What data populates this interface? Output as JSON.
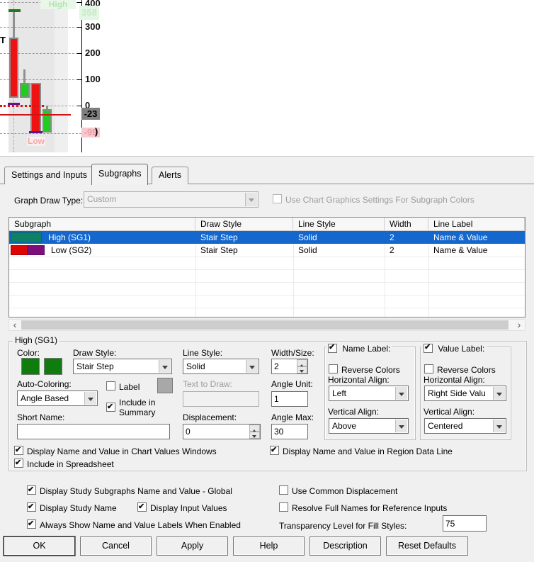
{
  "chart": {
    "y_axis": [
      "400",
      "300",
      "200",
      "100",
      "0"
    ],
    "last_price_badge": "-23",
    "low_value_badge": "-99",
    "high_value_badge": "358",
    "series_high_label": "High",
    "series_low_label": "Low",
    "clipped_paren": ")",
    "clipped_left_text": "T"
  },
  "icons": {
    "scroll_left": "‹",
    "scroll_right": "›"
  },
  "dialog": {
    "tabs": [
      {
        "label": "Settings and Inputs"
      },
      {
        "label": "Subgraphs"
      },
      {
        "label": "Alerts"
      }
    ],
    "graph_draw_type_label": "Graph Draw Type:",
    "graph_draw_type_value": "Custom",
    "use_chart_graphics_label": "Use Chart Graphics Settings For Subgraph Colors",
    "table": {
      "columns": [
        "Subgraph",
        "Draw Style",
        "Line Style",
        "Width",
        "Line Label"
      ],
      "rows": [
        {
          "subgraph": "High (SG1)",
          "draw_style": "Stair Step",
          "line_style": "Solid",
          "width": "2",
          "line_label": "Name & Value"
        },
        {
          "subgraph": "Low (SG2)",
          "draw_style": "Stair Step",
          "line_style": "Solid",
          "width": "2",
          "line_label": "Name & Value"
        }
      ]
    },
    "group": {
      "title": "High (SG1)",
      "color_label": "Color:",
      "draw_style_label": "Draw Style:",
      "draw_style_value": "Stair Step",
      "line_style_label": "Line Style:",
      "line_style_value": "Solid",
      "width_size_label": "Width/Size:",
      "width_size_value": "2",
      "auto_coloring_label": "Auto-Coloring:",
      "auto_coloring_value": "Angle Based",
      "label_checkbox_label": "Label",
      "text_to_draw_label": "Text to Draw:",
      "text_to_draw_value": "",
      "angle_unit_label": "Angle Unit:",
      "angle_unit_value": "1",
      "include_in_summary_label": "Include in Summary",
      "short_name_label": "Short Name:",
      "short_name_value": "",
      "displacement_label": "Displacement:",
      "displacement_value": "0",
      "angle_max_label": "Angle Max:",
      "angle_max_value": "30",
      "name_label_group": {
        "title": "Name Label:",
        "reverse_colors_label": "Reverse Colors",
        "horizontal_align_label": "Horizontal Align:",
        "horizontal_align_value": "Left",
        "vertical_align_label": "Vertical Align:",
        "vertical_align_value": "Above"
      },
      "value_label_group": {
        "title": "Value Label:",
        "reverse_colors_label": "Reverse Colors",
        "horizontal_align_label": "Horizontal Align:",
        "horizontal_align_value": "Right Side Valu",
        "vertical_align_label": "Vertical Align:",
        "vertical_align_value": "Centered"
      },
      "display_chart_values_label": "Display Name and Value in Chart Values Windows",
      "display_region_data_label": "Display Name and Value in Region Data Line",
      "include_spreadsheet_label": "Include in Spreadsheet"
    },
    "global": {
      "display_subgraphs_global_label": "Display Study Subgraphs Name and Value - Global",
      "use_common_displacement_label": "Use Common Displacement",
      "display_study_name_label": "Display Study Name",
      "display_input_values_label": "Display Input Values",
      "resolve_full_names_label": "Resolve Full Names for Reference Inputs",
      "always_show_labels_label": "Always Show Name and Value Labels When Enabled",
      "transparency_label": "Transparency Level for Fill Styles:",
      "transparency_value": "75"
    },
    "buttons": [
      "OK",
      "Cancel",
      "Apply",
      "Help",
      "Description",
      "Reset Defaults"
    ],
    "colors": {
      "selection": "#1467cd",
      "swatch_green": "#0e7d0e",
      "swatch_teal": "#0e8165",
      "swatch_red": "#dd0404",
      "swatch_purple": "#7d0f7d",
      "swatch_gray": "#a8a8a8"
    }
  }
}
